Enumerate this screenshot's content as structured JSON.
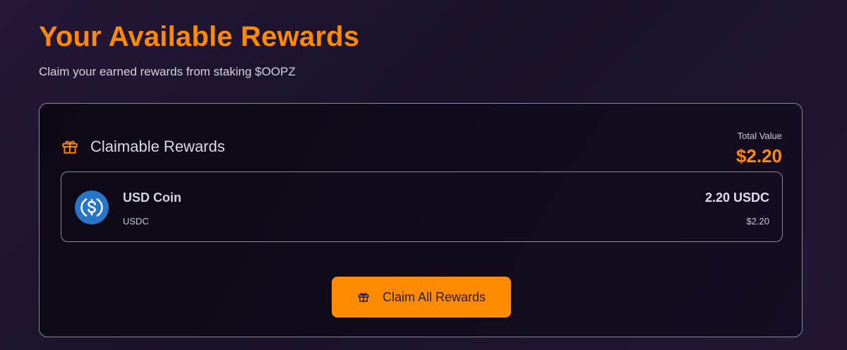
{
  "header": {
    "title": "Your Available Rewards",
    "subtitle": "Claim your earned rewards from staking $OOPZ"
  },
  "panel": {
    "title": "Claimable Rewards",
    "icon": "gift-icon",
    "total_label": "Total Value",
    "total_value": "$2.20",
    "rewards": [
      {
        "name": "USD Coin",
        "symbol": "USDC",
        "amount": "2.20 USDC",
        "usd_value": "$2.20",
        "icon": "usdc-icon"
      }
    ],
    "claim_button_label": "Claim All Rewards",
    "claim_button_icon": "gift-icon"
  },
  "colors": {
    "accent": "#ff8a00",
    "usdc_blue": "#2775ca",
    "border": "#8f8799"
  }
}
